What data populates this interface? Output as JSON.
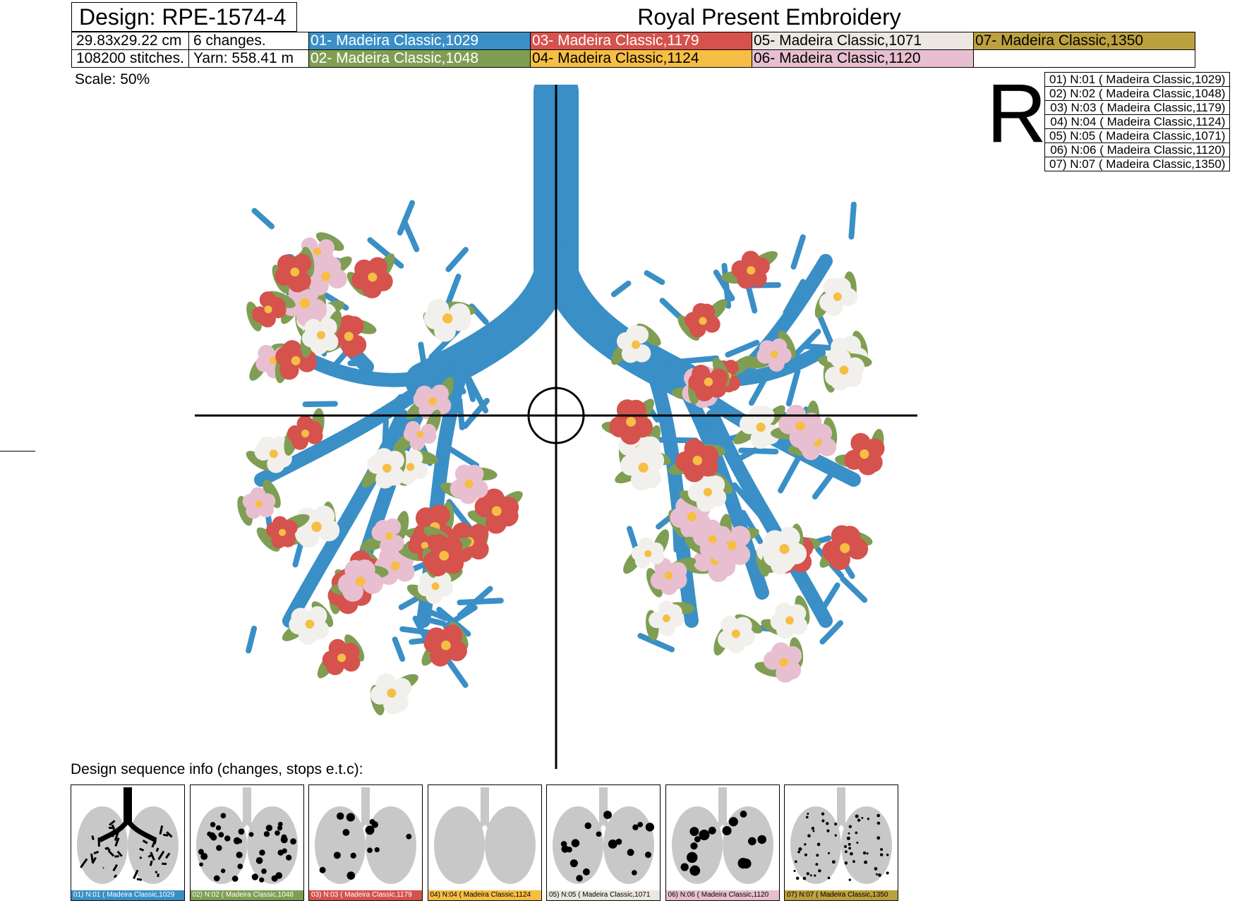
{
  "header": {
    "design_label": "Design: RPE-1574-4",
    "brand": "Royal Present Embroidery"
  },
  "info": {
    "size": "29.83x29.22 cm",
    "changes": "6 changes.",
    "stitches": "108200 stitches.",
    "yarn": "Yarn: 558.41 m"
  },
  "swatches": [
    {
      "label": "01- Madeira Classic,1029",
      "color": "#3a8fc6",
      "text_color": "#ffffff"
    },
    {
      "label": "02- Madeira Classic,1048",
      "color": "#7f9e53",
      "text_color": "#ffffff"
    },
    {
      "label": "03- Madeira Classic,1179",
      "color": "#d5524d",
      "text_color": "#ffffff"
    },
    {
      "label": "04- Madeira Classic,1124",
      "color": "#f6be45",
      "text_color": "#000000"
    },
    {
      "label": "05- Madeira Classic,1071",
      "color": "#ece7e0",
      "text_color": "#000000"
    },
    {
      "label": "06- Madeira Classic,1120",
      "color": "#e8bfd0",
      "text_color": "#000000"
    },
    {
      "label": "07- Madeira Classic,1350",
      "color": "#bca13e",
      "text_color": "#000000"
    }
  ],
  "scale": "Scale: 50%",
  "r_mark": "R",
  "legend": [
    "01) N:01 ( Madeira Classic,1029)",
    "02) N:02 ( Madeira Classic,1048)",
    "03) N:03 ( Madeira Classic,1179)",
    "04) N:04 ( Madeira Classic,1124)",
    "05) N:05 ( Madeira Classic,1071)",
    "06) N:06 ( Madeira Classic,1120)",
    "07) N:07 ( Madeira Classic,1350)"
  ],
  "sequence": {
    "title": "Design sequence info (changes, stops e.t.c):",
    "items": [
      {
        "label": "01) N:01 ( Madeira Classic,1029",
        "color": "#3a8fc6",
        "text_color": "#ffffff",
        "highlight": "airway"
      },
      {
        "label": "02) N:02 ( Madeira Classic,1048",
        "color": "#7f9e53",
        "text_color": "#ffffff",
        "highlight": "leaves"
      },
      {
        "label": "03) N:03 ( Madeira Classic,1179",
        "color": "#d5524d",
        "text_color": "#ffffff",
        "highlight": "red"
      },
      {
        "label": "04) N:04 ( Madeira Classic,1124",
        "color": "#f6be45",
        "text_color": "#000000",
        "highlight": "centers"
      },
      {
        "label": "05) N:05 ( Madeira Classic,1071",
        "color": "#ece7e0",
        "text_color": "#000000",
        "highlight": "white"
      },
      {
        "label": "06) N:06 ( Madeira Classic,1120",
        "color": "#e8bfd0",
        "text_color": "#000000",
        "highlight": "pink"
      },
      {
        "label": "07) N:07 ( Madeira Classic,1350",
        "color": "#bca13e",
        "text_color": "#000000",
        "highlight": "dots"
      }
    ]
  }
}
